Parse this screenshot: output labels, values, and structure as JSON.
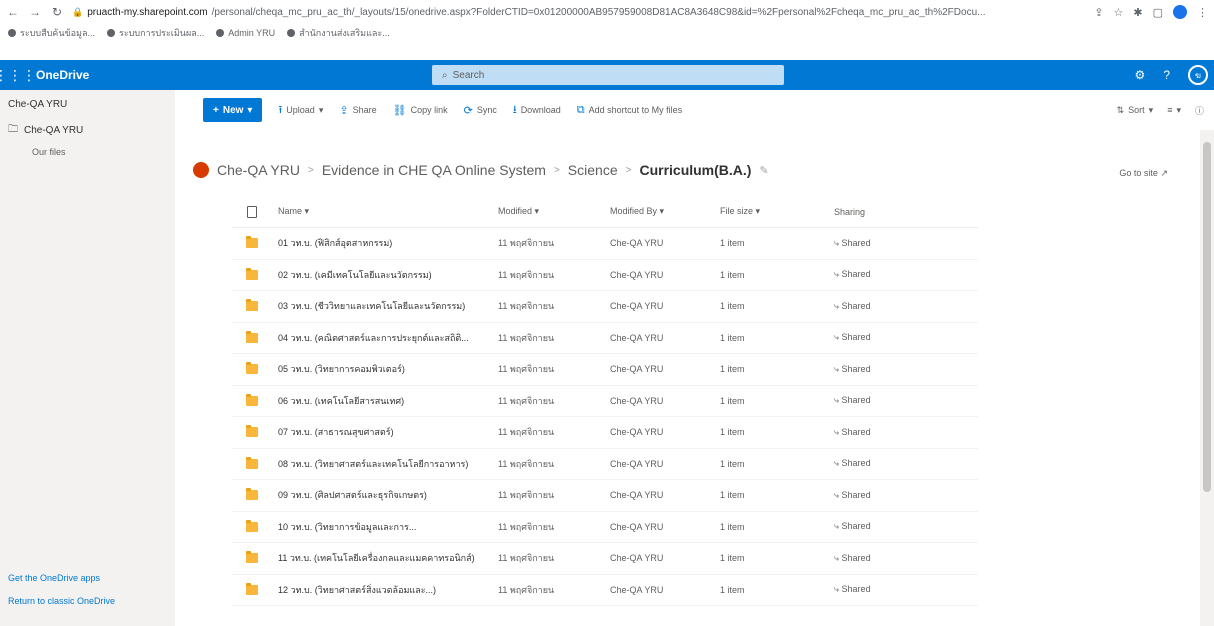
{
  "browser": {
    "url_host": "pruacth-my.sharepoint.com",
    "url_path": "/personal/cheqa_mc_pru_ac_th/_layouts/15/onedrive.aspx?FolderCTID=0x01200000AB957959008D81AC8A3648C98&id=%2Fpersonal%2Fcheqa_mc_pru_ac_th%2FDocu...",
    "bookmarks": [
      "ระบบสืบค้นข้อมูล...",
      "ระบบการประเมินผล...",
      "Admin YRU",
      "สำนักงานส่งเสริมและ..."
    ]
  },
  "suite": {
    "app_name": "OneDrive",
    "search_placeholder": "Search",
    "settings_icon": "⚙",
    "help_icon": "?",
    "avatar_initials": "ฆ"
  },
  "leftnav": {
    "title": "Che-QA YRU",
    "item": "Che-QA YRU",
    "subitem": "Our files",
    "get_apps": "Get the OneDrive apps",
    "return_classic": "Return to classic OneDrive"
  },
  "commandbar": {
    "new_label": "New",
    "upload": "Upload",
    "share": "Share",
    "copy_link": "Copy link",
    "sync": "Sync",
    "download": "Download",
    "add_shortcut": "Add shortcut to My files",
    "sort": "Sort",
    "view": "≡",
    "info": "ⓘ"
  },
  "breadcrumb": {
    "items": [
      "Che-QA YRU",
      "Evidence in CHE QA Online System",
      "Science"
    ],
    "current": "Curriculum(B.A.)",
    "go_to_site": "Go to site"
  },
  "table": {
    "headers": {
      "name": "Name",
      "modified": "Modified",
      "modified_by": "Modified By",
      "file_size": "File size",
      "sharing": "Sharing"
    },
    "rows": [
      {
        "name": "01 วท.บ. (ฟิสิกส์อุตสาหกรรม)",
        "modified": "11 พฤศจิกายน",
        "modified_by": "Che-QA YRU",
        "size": "1 item",
        "sharing": "Shared"
      },
      {
        "name": "02 วท.บ. (เคมีเทคโนโลยีและนวัตกรรม)",
        "modified": "11 พฤศจิกายน",
        "modified_by": "Che-QA YRU",
        "size": "1 item",
        "sharing": "Shared"
      },
      {
        "name": "03 วท.บ. (ชีววิทยาและเทคโนโลยีและนวัตกรรม)",
        "modified": "11 พฤศจิกายน",
        "modified_by": "Che-QA YRU",
        "size": "1 item",
        "sharing": "Shared"
      },
      {
        "name": "04 วท.บ. (คณิตศาสตร์และการประยุกต์และสถิติ...",
        "modified": "11 พฤศจิกายน",
        "modified_by": "Che-QA YRU",
        "size": "1 item",
        "sharing": "Shared"
      },
      {
        "name": "05 วท.บ. (วิทยาการคอมพิวเตอร์)",
        "modified": "11 พฤศจิกายน",
        "modified_by": "Che-QA YRU",
        "size": "1 item",
        "sharing": "Shared"
      },
      {
        "name": "06 วท.บ. (เทคโนโลยีสารสนเทศ)",
        "modified": "11 พฤศจิกายน",
        "modified_by": "Che-QA YRU",
        "size": "1 item",
        "sharing": "Shared"
      },
      {
        "name": "07 วท.บ. (สาธารณสุขศาสตร์)",
        "modified": "11 พฤศจิกายน",
        "modified_by": "Che-QA YRU",
        "size": "1 item",
        "sharing": "Shared"
      },
      {
        "name": "08 วท.บ. (วิทยาศาสตร์และเทคโนโลยีการอาหาร)",
        "modified": "11 พฤศจิกายน",
        "modified_by": "Che-QA YRU",
        "size": "1 item",
        "sharing": "Shared"
      },
      {
        "name": "09 วท.บ. (ศิลปศาสตร์และธุรกิจเกษตร)",
        "modified": "11 พฤศจิกายน",
        "modified_by": "Che-QA YRU",
        "size": "1 item",
        "sharing": "Shared"
      },
      {
        "name": "10 วท.บ. (วิทยาการข้อมูลและการ...",
        "modified": "11 พฤศจิกายน",
        "modified_by": "Che-QA YRU",
        "size": "1 item",
        "sharing": "Shared"
      },
      {
        "name": "11 วท.บ. (เทคโนโลยีเครื่องกลและแมคคาทรอนิกส์)",
        "modified": "11 พฤศจิกายน",
        "modified_by": "Che-QA YRU",
        "size": "1 item",
        "sharing": "Shared"
      },
      {
        "name": "12 วท.บ. (วิทยาศาสตร์สิ่งแวดล้อมและ...)",
        "modified": "11 พฤศจิกายน",
        "modified_by": "Che-QA YRU",
        "size": "1 item",
        "sharing": "Shared"
      }
    ]
  },
  "colors": {
    "brand": "#0078d4",
    "folder": "#f8b73a",
    "leftnav_bg": "#f3f2f1"
  }
}
